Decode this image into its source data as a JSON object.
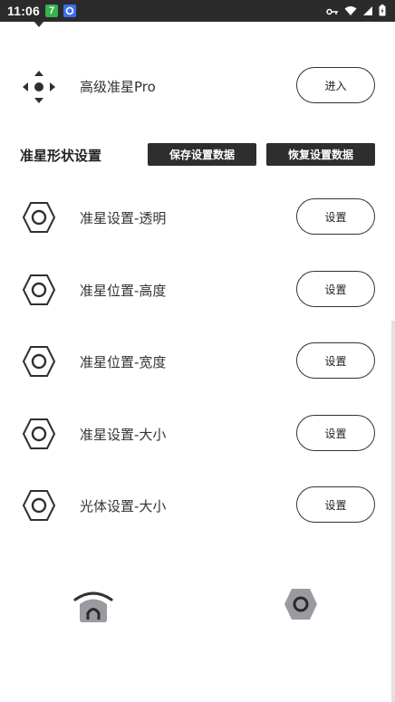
{
  "status_bar": {
    "time": "11:06",
    "badge_1": "7",
    "badge_1_color": "#37b24d",
    "badge_2_color": "#3b6ff2",
    "icons": [
      "key-icon",
      "wifi-icon",
      "signal-icon",
      "battery-icon"
    ]
  },
  "top_row": {
    "label": "高级准星Pro",
    "button": "进入",
    "icon": "dpad-icon"
  },
  "section": {
    "title": "准星形状设置",
    "save_button": "保存设置数据",
    "restore_button": "恢复设置数据"
  },
  "settings": [
    {
      "label": "准星设置-透明",
      "button": "设置",
      "icon": "hexagon-nut-icon"
    },
    {
      "label": "准星位置-高度",
      "button": "设置",
      "icon": "hexagon-nut-icon"
    },
    {
      "label": "准星位置-宽度",
      "button": "设置",
      "icon": "hexagon-nut-icon"
    },
    {
      "label": "准星设置-大小",
      "button": "设置",
      "icon": "hexagon-nut-icon"
    },
    {
      "label": "光体设置-大小",
      "button": "设置",
      "icon": "hexagon-nut-icon"
    }
  ],
  "bottom_nav": {
    "items": [
      {
        "name": "home",
        "icon": "home-icon"
      },
      {
        "name": "settings",
        "icon": "hexagon-settings-icon",
        "active": true
      }
    ]
  },
  "colors": {
    "accent_dark": "#2e2e2e",
    "status_bar": "#2b2b2b",
    "nav_icon": "#555555",
    "nav_icon_active": "#9a9aa0"
  }
}
